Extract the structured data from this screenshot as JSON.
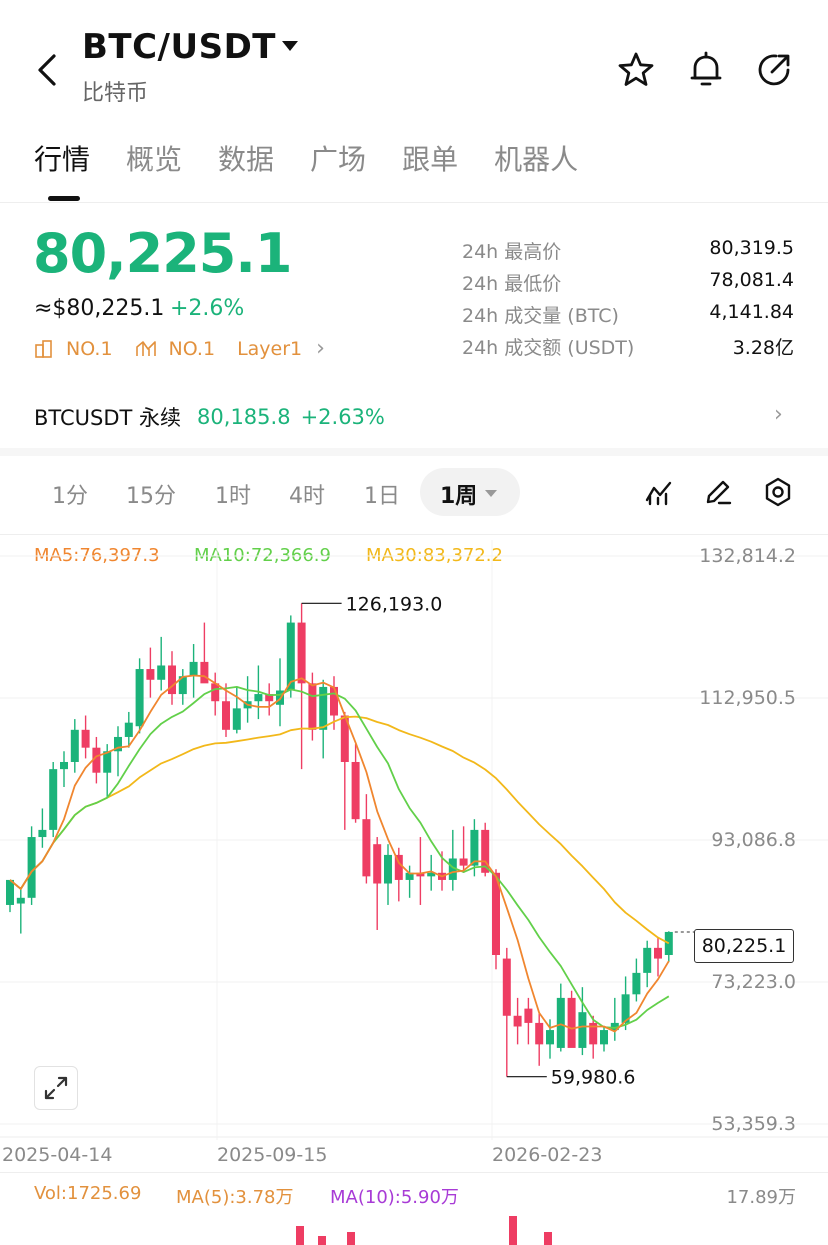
{
  "header": {
    "pair": "BTC/USDT",
    "name_cn": "比特币"
  },
  "tabs": [
    "行情",
    "概览",
    "数据",
    "广场",
    "跟单",
    "机器人"
  ],
  "active_tab": "行情",
  "price": {
    "last": "80,225.1",
    "usd": "≈$80,225.1",
    "change": "+2.6%",
    "rank1": "NO.1",
    "rank2": "NO.1",
    "category": "Layer1"
  },
  "stats": [
    {
      "label": "24h 最高价",
      "value": "80,319.5"
    },
    {
      "label": "24h 最低价",
      "value": "78,081.4"
    },
    {
      "label": "24h 成交量 (BTC)",
      "value": "4,141.84"
    },
    {
      "label": "24h 成交额 (USDT)",
      "value": "3.28亿"
    }
  ],
  "perpetual": {
    "name": "BTCUSDT 永续",
    "price": "80,185.8",
    "change": "+2.63%"
  },
  "timeframes": [
    "1分",
    "15分",
    "1时",
    "4时",
    "1日"
  ],
  "timeframe_selected": "1周",
  "ma_legend": {
    "ma5": "MA5:76,397.3",
    "ma10": "MA10:72,366.9",
    "ma30": "MA30:83,372.2"
  },
  "volume_legend": {
    "vol": "Vol:1725.69",
    "ma5": "MA(5):3.78万",
    "ma10": "MA(10):5.90万",
    "max": "17.89万"
  },
  "colors": {
    "up": "#1bb37a",
    "down": "#ee3d63",
    "ma5": "#f0862f",
    "ma10": "#62d04a",
    "ma30": "#f2b81a",
    "rank": "#e2913d"
  },
  "chart_data": {
    "type": "candlestick",
    "interval": "1周",
    "y_axis_labels": [
      "132,814.2",
      "112,950.5",
      "93,086.8",
      "73,223.0",
      "53,359.3"
    ],
    "x_axis_labels": [
      "2025-04-14",
      "2025-09-15",
      "2026-02-23"
    ],
    "ylim": [
      53359.3,
      132814.2
    ],
    "high_marker": "126,193.0",
    "low_marker": "59,980.6",
    "last_price_label": "80,225.1",
    "candles": [
      {
        "o": 84000,
        "h": 87000,
        "l": 83000,
        "c": 87500
      },
      {
        "o": 84200,
        "h": 86500,
        "l": 80000,
        "c": 85000
      },
      {
        "o": 85000,
        "h": 95000,
        "l": 84000,
        "c": 93500
      },
      {
        "o": 93500,
        "h": 97500,
        "l": 92000,
        "c": 94500
      },
      {
        "o": 94500,
        "h": 104000,
        "l": 93500,
        "c": 103000
      },
      {
        "o": 103000,
        "h": 105500,
        "l": 100500,
        "c": 104000
      },
      {
        "o": 104000,
        "h": 110000,
        "l": 102500,
        "c": 108500
      },
      {
        "o": 108500,
        "h": 110500,
        "l": 104500,
        "c": 106000
      },
      {
        "o": 106000,
        "h": 107500,
        "l": 101000,
        "c": 102500
      },
      {
        "o": 102500,
        "h": 106500,
        "l": 99000,
        "c": 105500
      },
      {
        "o": 105500,
        "h": 109000,
        "l": 102000,
        "c": 107500
      },
      {
        "o": 107500,
        "h": 111000,
        "l": 106000,
        "c": 109500
      },
      {
        "o": 109000,
        "h": 118500,
        "l": 108000,
        "c": 117000
      },
      {
        "o": 117000,
        "h": 120000,
        "l": 113000,
        "c": 115500
      },
      {
        "o": 115500,
        "h": 121500,
        "l": 114000,
        "c": 117500
      },
      {
        "o": 117500,
        "h": 119500,
        "l": 112000,
        "c": 113500
      },
      {
        "o": 113500,
        "h": 117000,
        "l": 112000,
        "c": 116000
      },
      {
        "o": 116000,
        "h": 120500,
        "l": 113000,
        "c": 118000
      },
      {
        "o": 118000,
        "h": 123500,
        "l": 116000,
        "c": 115000
      },
      {
        "o": 115000,
        "h": 116500,
        "l": 110500,
        "c": 112500
      },
      {
        "o": 112500,
        "h": 115000,
        "l": 107500,
        "c": 108500
      },
      {
        "o": 108500,
        "h": 114500,
        "l": 108000,
        "c": 111500
      },
      {
        "o": 111500,
        "h": 116000,
        "l": 109500,
        "c": 112500
      },
      {
        "o": 112500,
        "h": 117500,
        "l": 110000,
        "c": 113500
      },
      {
        "o": 113500,
        "h": 115000,
        "l": 110500,
        "c": 112500
      },
      {
        "o": 112000,
        "h": 118500,
        "l": 109000,
        "c": 114000
      },
      {
        "o": 114000,
        "h": 124500,
        "l": 113000,
        "c": 123500
      },
      {
        "o": 123500,
        "h": 126193,
        "l": 103000,
        "c": 115000
      },
      {
        "o": 115000,
        "h": 116500,
        "l": 107000,
        "c": 108500
      },
      {
        "o": 108500,
        "h": 115500,
        "l": 104500,
        "c": 114500
      },
      {
        "o": 114500,
        "h": 116000,
        "l": 108500,
        "c": 110500
      },
      {
        "o": 110500,
        "h": 111000,
        "l": 94500,
        "c": 104000
      },
      {
        "o": 104000,
        "h": 106500,
        "l": 95500,
        "c": 96000
      },
      {
        "o": 96000,
        "h": 99500,
        "l": 87000,
        "c": 88000
      },
      {
        "o": 92500,
        "h": 93500,
        "l": 80500,
        "c": 87000
      },
      {
        "o": 87000,
        "h": 92500,
        "l": 84000,
        "c": 91000
      },
      {
        "o": 91000,
        "h": 92000,
        "l": 84500,
        "c": 87500
      },
      {
        "o": 87500,
        "h": 89500,
        "l": 85000,
        "c": 88500
      },
      {
        "o": 88500,
        "h": 93500,
        "l": 84000,
        "c": 88000
      },
      {
        "o": 88000,
        "h": 91000,
        "l": 86000,
        "c": 88500
      },
      {
        "o": 88500,
        "h": 91500,
        "l": 86000,
        "c": 87500
      },
      {
        "o": 87500,
        "h": 94500,
        "l": 86000,
        "c": 90500
      },
      {
        "o": 90500,
        "h": 95000,
        "l": 88500,
        "c": 89500
      },
      {
        "o": 89500,
        "h": 96000,
        "l": 88000,
        "c": 94500
      },
      {
        "o": 94500,
        "h": 95500,
        "l": 88000,
        "c": 88500
      },
      {
        "o": 88500,
        "h": 89000,
        "l": 75000,
        "c": 77000
      },
      {
        "o": 76500,
        "h": 78000,
        "l": 59980.6,
        "c": 68500
      },
      {
        "o": 68500,
        "h": 71000,
        "l": 64500,
        "c": 67000
      },
      {
        "o": 69500,
        "h": 71000,
        "l": 64500,
        "c": 67500
      },
      {
        "o": 67500,
        "h": 69000,
        "l": 61500,
        "c": 64500
      },
      {
        "o": 64500,
        "h": 68000,
        "l": 62500,
        "c": 66500
      },
      {
        "o": 64000,
        "h": 73000,
        "l": 63500,
        "c": 71000
      },
      {
        "o": 71000,
        "h": 72000,
        "l": 64500,
        "c": 64000
      },
      {
        "o": 64000,
        "h": 72500,
        "l": 63000,
        "c": 69000
      },
      {
        "o": 67500,
        "h": 68500,
        "l": 62500,
        "c": 64500
      },
      {
        "o": 64500,
        "h": 67000,
        "l": 63500,
        "c": 66500
      },
      {
        "o": 66500,
        "h": 71000,
        "l": 65000,
        "c": 67500
      },
      {
        "o": 67500,
        "h": 74000,
        "l": 66500,
        "c": 71500
      },
      {
        "o": 71500,
        "h": 76500,
        "l": 70500,
        "c": 74500
      },
      {
        "o": 74500,
        "h": 79000,
        "l": 72500,
        "c": 78000
      },
      {
        "o": 78000,
        "h": 79500,
        "l": 74000,
        "c": 76500
      },
      {
        "o": 77000,
        "h": 80320,
        "l": 76000,
        "c": 80225
      }
    ]
  }
}
